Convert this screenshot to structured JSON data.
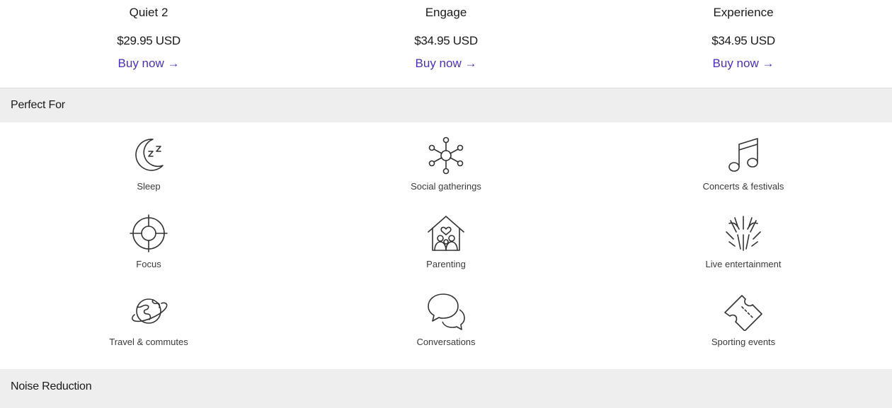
{
  "products": [
    {
      "name": "Quiet 2",
      "price": "$29.95 USD",
      "buy_label": "Buy now →"
    },
    {
      "name": "Engage",
      "price": "$34.95 USD",
      "buy_label": "Buy now →"
    },
    {
      "name": "Experience",
      "price": "$34.95 USD",
      "buy_label": "Buy now →"
    }
  ],
  "perfect_for": {
    "title": "Perfect For",
    "items": [
      {
        "label": "Sleep",
        "icon": "sleep-moon-icon"
      },
      {
        "label": "Social gatherings",
        "icon": "social-network-icon"
      },
      {
        "label": "Concerts & festivals",
        "icon": "music-note-icon"
      },
      {
        "label": "Focus",
        "icon": "target-icon"
      },
      {
        "label": "Parenting",
        "icon": "family-house-icon"
      },
      {
        "label": "Live entertainment",
        "icon": "fireworks-icon"
      },
      {
        "label": "Travel & commutes",
        "icon": "planet-icon"
      },
      {
        "label": "Conversations",
        "icon": "chat-bubbles-icon"
      },
      {
        "label": "Sporting events",
        "icon": "ticket-icon"
      }
    ]
  },
  "noise_reduction": {
    "title": "Noise Reduction"
  },
  "colors": {
    "accent": "#4d2fb5",
    "section_bg": "#eeeeee",
    "text": "#1a1a1a"
  }
}
